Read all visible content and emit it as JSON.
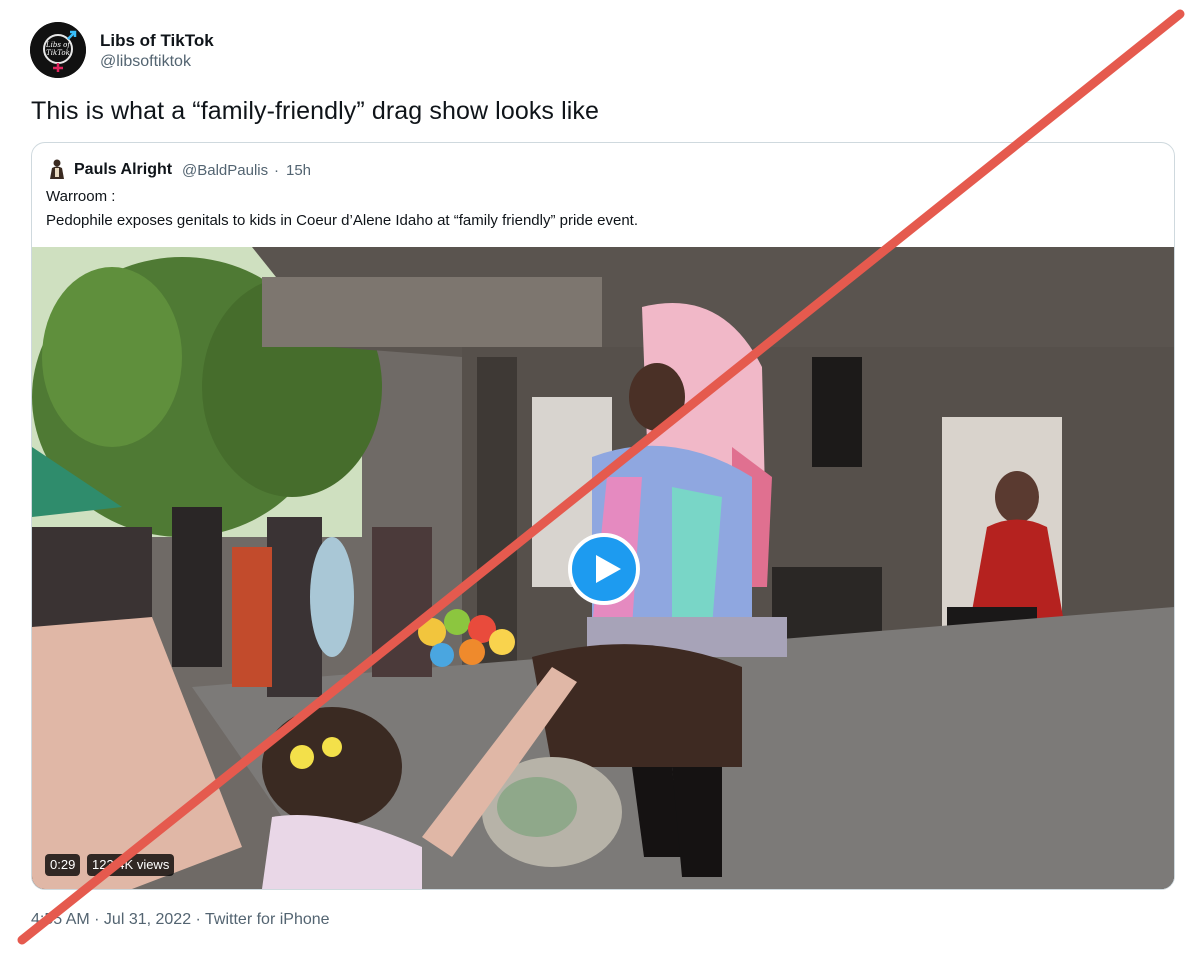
{
  "tweet": {
    "author_name": "Libs of TikTok",
    "author_handle": "@libsoftiktok",
    "avatar_logo_text": "Libs of TikTok",
    "text": "This is what a “family-friendly” drag show looks like",
    "footer": "4:55 AM · Jul 31, 2022 · Twitter for iPhone"
  },
  "quote": {
    "author_name": "Pauls Alright",
    "author_handle": "@BaldPaulis",
    "separator": "·",
    "time": "15h",
    "text_line1": "Warroom :",
    "text_line2": "Pedophile exposes genitals to kids in Coeur d’Alene Idaho at “family friendly” pride event.",
    "video": {
      "duration": "0:29",
      "views": "123.4K views"
    }
  },
  "colors": {
    "play_button": "#1d9bf0",
    "cross_line": "#e55a4e",
    "secondary_text": "#536471"
  }
}
